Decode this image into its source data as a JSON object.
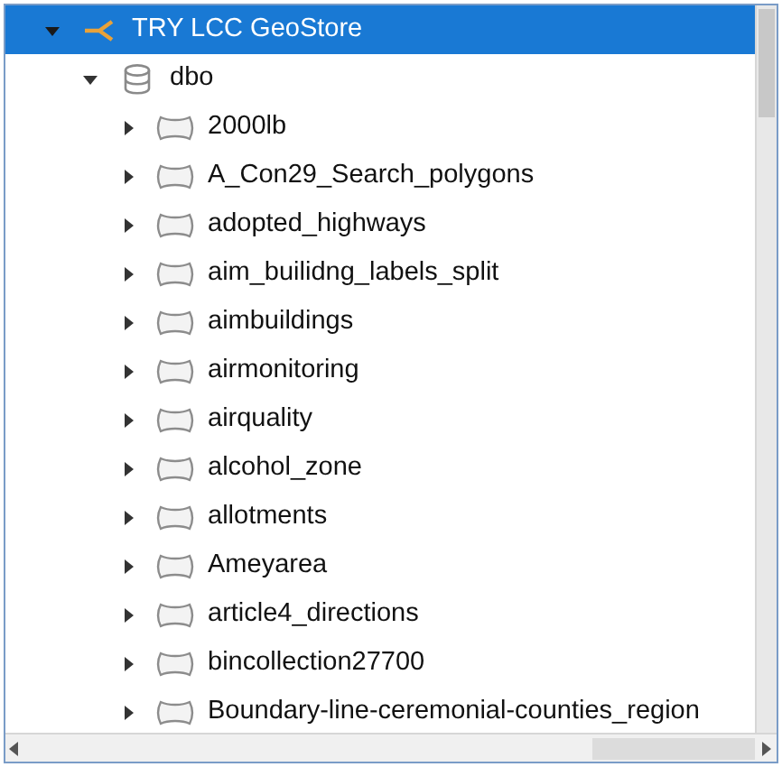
{
  "tree": [
    {
      "label": "TRY LCC GeoStore",
      "kind": "connection",
      "expanded": true,
      "selected": true,
      "children": [
        {
          "label": "dbo",
          "kind": "schema",
          "expanded": true,
          "selected": false,
          "children": [
            {
              "label": "2000lb",
              "kind": "table",
              "expanded": false,
              "selected": false
            },
            {
              "label": "A_Con29_Search_polygons",
              "kind": "table",
              "expanded": false,
              "selected": false
            },
            {
              "label": "adopted_highways",
              "kind": "table",
              "expanded": false,
              "selected": false
            },
            {
              "label": "aim_builidng_labels_split",
              "kind": "table",
              "expanded": false,
              "selected": false
            },
            {
              "label": "aimbuildings",
              "kind": "table",
              "expanded": false,
              "selected": false
            },
            {
              "label": "airmonitoring",
              "kind": "table",
              "expanded": false,
              "selected": false
            },
            {
              "label": "airquality",
              "kind": "table",
              "expanded": false,
              "selected": false
            },
            {
              "label": "alcohol_zone",
              "kind": "table",
              "expanded": false,
              "selected": false
            },
            {
              "label": "allotments",
              "kind": "table",
              "expanded": false,
              "selected": false
            },
            {
              "label": "Ameyarea",
              "kind": "table",
              "expanded": false,
              "selected": false
            },
            {
              "label": "article4_directions",
              "kind": "table",
              "expanded": false,
              "selected": false
            },
            {
              "label": "bincollection27700",
              "kind": "table",
              "expanded": false,
              "selected": false
            },
            {
              "label": "Boundary-line-ceremonial-counties_region",
              "kind": "table",
              "expanded": false,
              "selected": false
            }
          ]
        }
      ]
    }
  ]
}
